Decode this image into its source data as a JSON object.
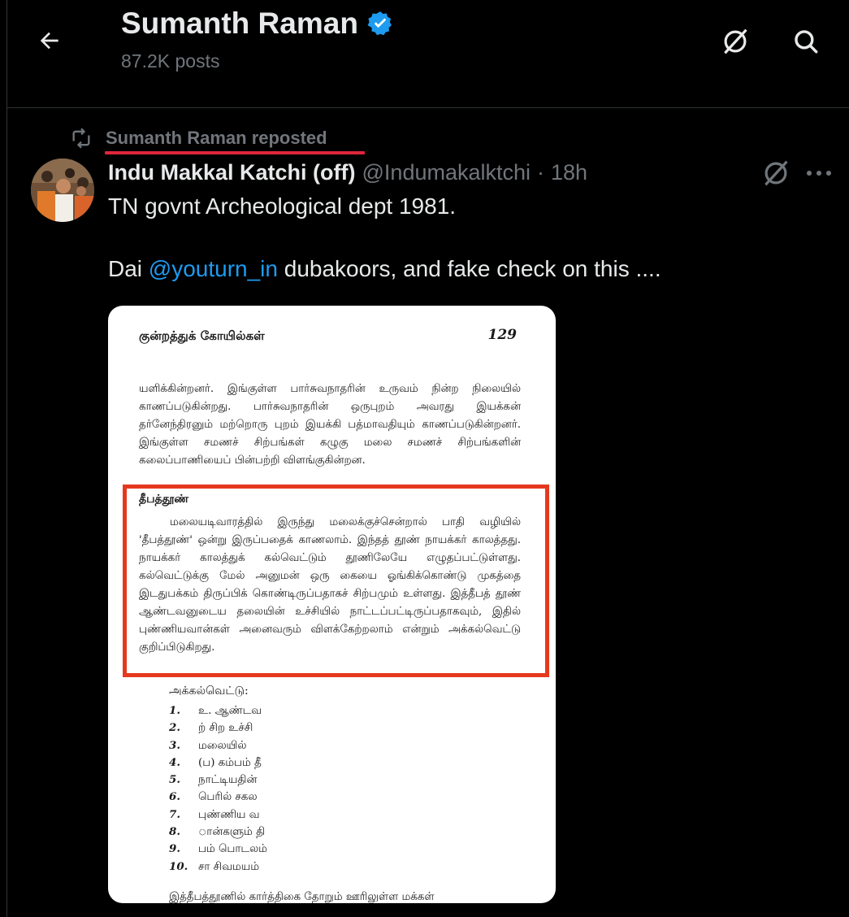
{
  "header": {
    "name": "Sumanth Raman",
    "posts": "87.2K posts",
    "icons": {
      "back": "arrow-left-icon",
      "verified": "verified-badge-icon",
      "grok": "grok-icon",
      "search": "search-icon"
    }
  },
  "repost": {
    "label": "Sumanth Raman reposted",
    "icon": "repost-icon"
  },
  "tweet": {
    "author_name": "Indu Makkal Katchi (off)",
    "handle": "@Indumakalktchi",
    "separator": "·",
    "time": "18h",
    "line1": "TN govnt Archeological dept 1981.",
    "line2_prefix": "Dai ",
    "mention": "@youturn_in",
    "line2_suffix": " dubakoors, and fake check on this ....",
    "icons": {
      "grok": "grok-icon",
      "more": "more-icon"
    }
  },
  "document": {
    "header_title": "குன்றத்துக் கோயில்கள்",
    "page_number": "129",
    "para1": "யளிக்கின்றனர். இங்குள்ள பார்சுவநாதரின் உருவம் நின்ற நிலையில் காணப்படுகின்றது. பார்சுவநாதரின் ஒருபுறம் அவரது இயக்கன் தர்னேந்திரனும் மற்றொரு புறம் இயக்கி பத்மாவதியும் காணப்படுகின்றனர். இங்குள்ள சமணச் சிற்பங்கள் கழுகு மலை சமணச் சிற்பங்களின் கலைப்பாணியைப் பின்பற்றி விளங்குகின்றன.",
    "subheading": "தீபத்தூண்",
    "para2": "மலையடிவாரத்தில் இருந்து மலைக்குச்சென்றால் பாதி வழியில் 'தீபத்தூண்' ஒன்று இருப்பதைக் காணலாம். இந்தத் தூண் நாயக்கர் காலத்தது. நாயக்கர் காலத்துக் கல்வெட்டும் தூணிலேயே எழுதப்பட்டுள்ளது. கல்வெட்டுக்கு மேல் அனுமன் ஒரு கையை ஓங்கிக்கொண்டு முகத்தை இடதுபக்கம் திருப்பிக் கொண்டிருப்பதாகச் சிற்பமும் உள்ளது. இத்தீபத் தூண் ஆண்டவனுடைய தலையின் உச்சியில் நாட்டப்பட்டிருப்பதாகவும், இதில் புண்ணியவான்கள் அனைவரும் விளக்கேற்றலாம் என்றும் அக்கல்வெட்டு குறிப்பிடுகிறது.",
    "inscription_label": "அக்கல்வெட்டு:",
    "inscription_lines": [
      {
        "n": "1.",
        "t": "உ. ஆண்டவ"
      },
      {
        "n": "2.",
        "t": "ற் சிற உச்சி"
      },
      {
        "n": "3.",
        "t": "மலையில்"
      },
      {
        "n": "4.",
        "t": "(ப) கம்பம் தீ"
      },
      {
        "n": "5.",
        "t": "நாட்டியதின்"
      },
      {
        "n": "6.",
        "t": "பெரில் சகல"
      },
      {
        "n": "7.",
        "t": "புண்ணிய வ"
      },
      {
        "n": "8.",
        "t": "ான்களும் தி"
      },
      {
        "n": "9.",
        "t": "பம் பொடலம்"
      },
      {
        "n": "10.",
        "t": "சா சிவமயம்"
      }
    ],
    "footer_line": "இத்தீபத்தூணில் கார்த்திகை தோறும் ஊரிலுள்ள மக்கள்"
  },
  "colors": {
    "background": "#000000",
    "text": "#e7e9ea",
    "muted": "#71767b",
    "accent": "#1d9bf0",
    "highlight_red": "#e5391f"
  }
}
